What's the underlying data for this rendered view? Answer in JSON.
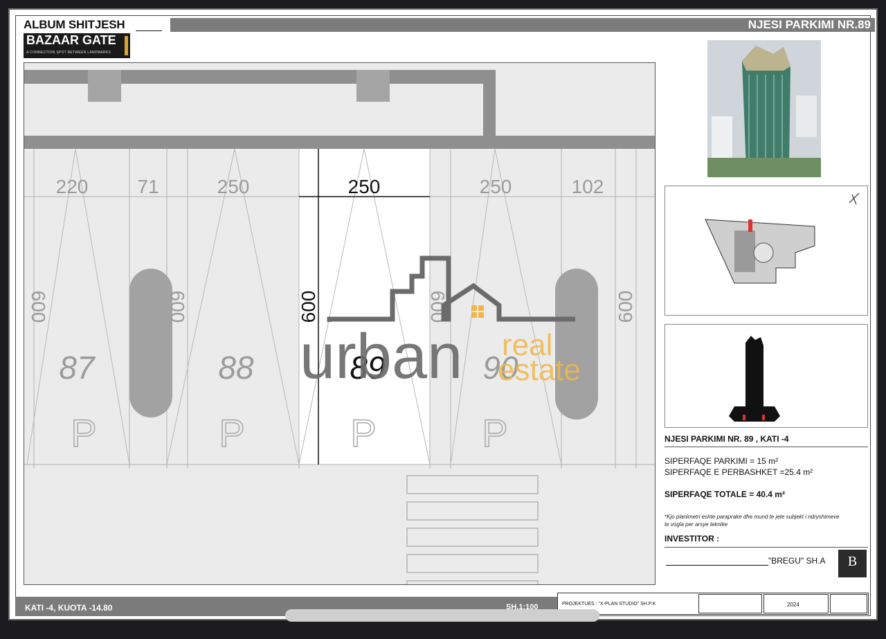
{
  "header": {
    "album_title": "ALBUM SHITJESH",
    "brand_name": "BAZAAR GATE",
    "brand_tagline": "A CONNECTION SPOT BETWEEN LANDMARKS",
    "unit_title": "NJESI PARKIMI NR.89"
  },
  "plan": {
    "dimensions_top": [
      "220",
      "71",
      "250",
      "250",
      "250",
      "102"
    ],
    "space_depths": [
      "600",
      "600",
      "600",
      "600",
      "600"
    ],
    "spaces": [
      {
        "number": "87",
        "symbol": "P"
      },
      {
        "number": "88",
        "symbol": "P"
      },
      {
        "number": "89",
        "symbol": "P",
        "highlighted": true
      },
      {
        "number": "90",
        "symbol": "P"
      }
    ]
  },
  "watermark": {
    "word": "urban",
    "word2": "real",
    "word3": "estate",
    "accent_color": "#f0b64a",
    "main_color": "#6b6b6b"
  },
  "info": {
    "heading": "NJESI PARKIMI NR. 89 , KATI -4",
    "parking_area": "SIPERFAQE PARKIMI = 15 m²",
    "common_area": "SIPERFAQE E PERBASHKET =25.4 m²",
    "total_area": "SIPERFAQE TOTALE = 40.4 m²",
    "note_line1": "*Kjo planimetri eshte paraprake dhe mund te jete subjekt i ndryshimeve",
    "note_line2": "te vogla per arsye teknike",
    "investor_label": "INVESTITOR :",
    "investor_name": "\"BREGU\" SH.A",
    "investor_logo_text": "B"
  },
  "footer": {
    "level": "KATI -4, KUOTA -14.80",
    "scale": "SH.1:100",
    "designer": "PROJEKTUES : \"X-PLAN STUDIO\" SH.P.K",
    "year": "2024"
  },
  "colors": {
    "frame_gray": "#7b7b7b",
    "plan_bg": "#ebebeb",
    "highlight_space": "#ffffff"
  }
}
